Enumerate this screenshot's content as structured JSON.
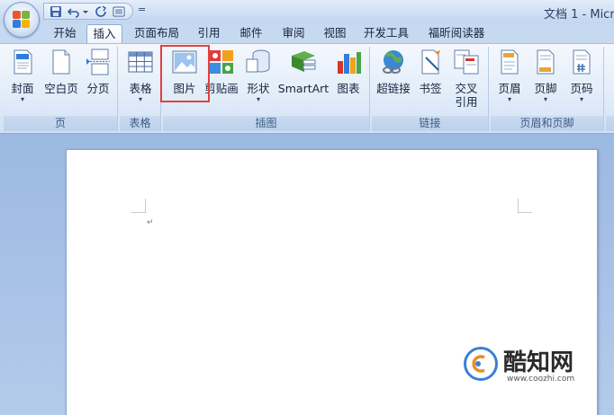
{
  "window": {
    "title": "文档 1 - Micr"
  },
  "quick_access": {
    "more": "="
  },
  "tabs": [
    "开始",
    "插入",
    "页面布局",
    "引用",
    "邮件",
    "审阅",
    "视图",
    "开发工具",
    "福昕阅读器"
  ],
  "active_tab": "插入",
  "groups": {
    "pages": {
      "label": "页",
      "buttons": [
        "封面",
        "空白页",
        "分页"
      ]
    },
    "tables": {
      "label": "表格",
      "buttons": [
        "表格"
      ]
    },
    "illustrations": {
      "label": "插图",
      "buttons": [
        "图片",
        "剪贴画",
        "形状",
        "SmartArt",
        "图表"
      ]
    },
    "links": {
      "label": "链接",
      "buttons": [
        "超链接",
        "书签",
        "交叉\n引用"
      ]
    },
    "header_footer": {
      "label": "页眉和页脚",
      "buttons": [
        "页眉",
        "页脚",
        "页码"
      ]
    }
  },
  "dropdown_arrow": "▾",
  "document": {
    "paragraph_mark": "↵"
  },
  "watermark": {
    "text": "酷知网",
    "url": "www.coozhi.com"
  },
  "colors": {
    "highlight": "#e04040",
    "accent": "#3b7fd6"
  }
}
